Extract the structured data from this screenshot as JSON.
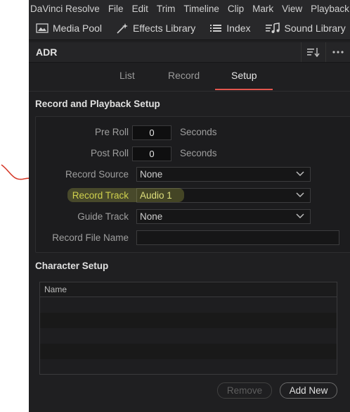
{
  "menu": [
    "DaVinci Resolve",
    "File",
    "Edit",
    "Trim",
    "Timeline",
    "Clip",
    "Mark",
    "View",
    "Playback"
  ],
  "toolbar": {
    "media_pool": "Media Pool",
    "effects_library": "Effects Library",
    "index": "Index",
    "sound_library": "Sound Library"
  },
  "panel": {
    "title": "ADR"
  },
  "tabs": [
    "List",
    "Record",
    "Setup"
  ],
  "active_tab": "Setup",
  "record_setup": {
    "heading": "Record and Playback Setup",
    "pre_roll_label": "Pre Roll",
    "pre_roll_value": "0",
    "pre_roll_unit": "Seconds",
    "post_roll_label": "Post Roll",
    "post_roll_value": "0",
    "post_roll_unit": "Seconds",
    "record_source_label": "Record Source",
    "record_source_value": "None",
    "record_track_label": "Record Track",
    "record_track_value": "Audio 1",
    "guide_track_label": "Guide Track",
    "guide_track_value": "None",
    "record_file_name_label": "Record File Name",
    "record_file_name_value": ""
  },
  "character_setup": {
    "heading": "Character Setup",
    "column_name": "Name",
    "remove_label": "Remove",
    "add_new_label": "Add New"
  },
  "colors": {
    "accent": "#e3564e",
    "annotation_red": "#d63a2a",
    "highlight": "#e6eb5a"
  }
}
